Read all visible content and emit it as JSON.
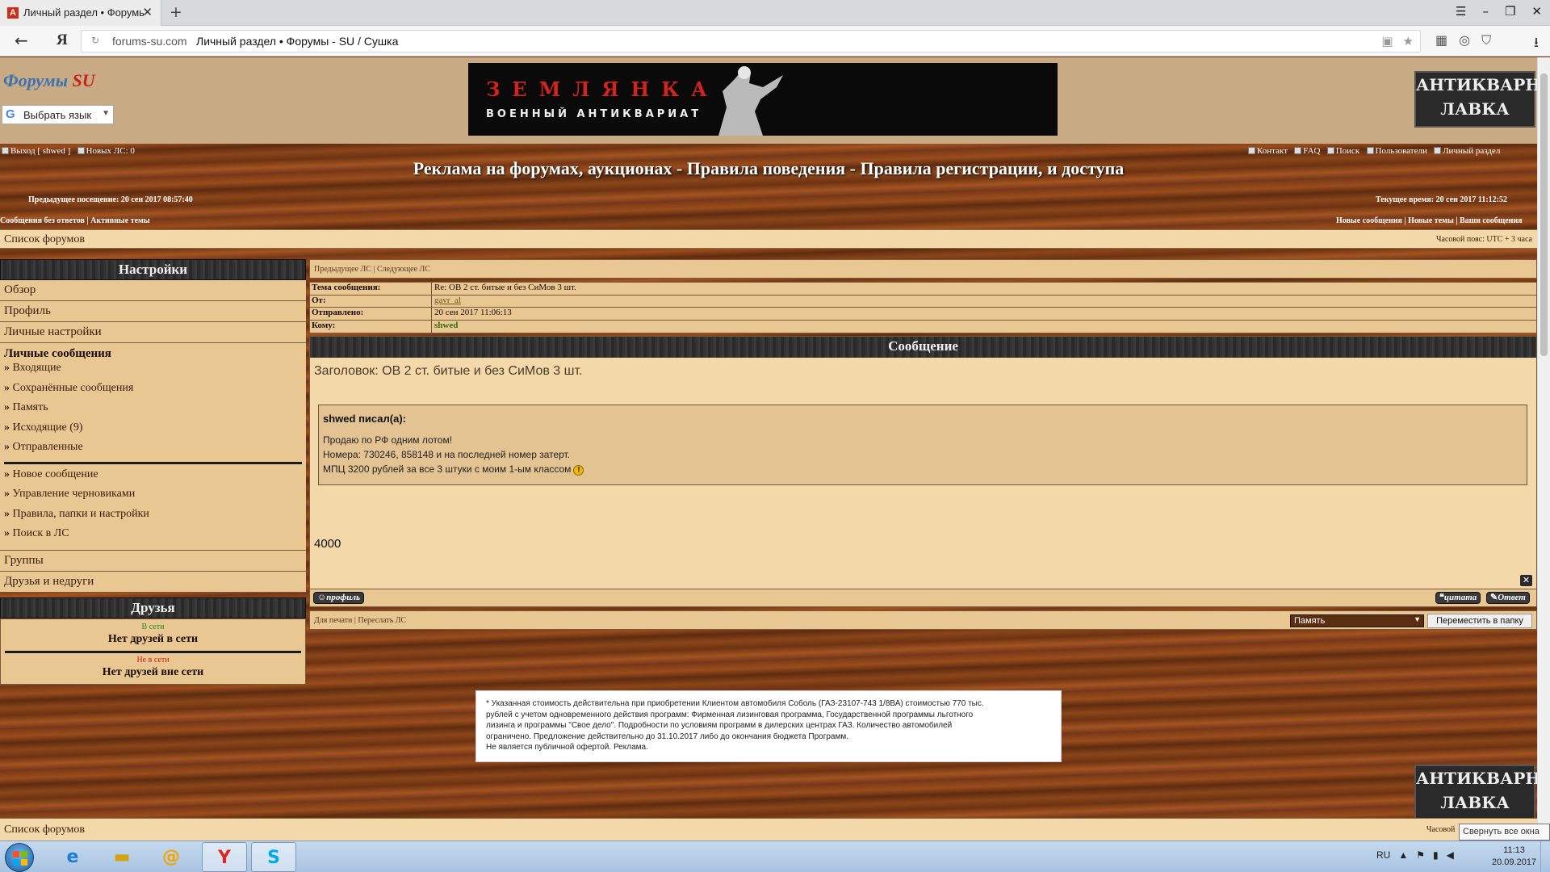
{
  "browser": {
    "tab_title": "Личный раздел • Форумы - SU / Сушка",
    "tab_icon": "A",
    "new_tab": "+",
    "close_tab": "✕",
    "yandex_logo": "Я",
    "url_host": "forums-su.com",
    "url_path": "Личный раздел • Форумы - SU / Сушка"
  },
  "header": {
    "logo_part1": "Форумы ",
    "logo_part2": "SU",
    "translate_label": "Выбрать язык",
    "banner_title": "ЗЕМЛЯНКА",
    "banner_subtitle": "ВОЕННЫЙ АНТИКВАРИАТ",
    "side_banner_line1": "АНТИКВАРНАЯ",
    "side_banner_line2": "ЛАВКА"
  },
  "toplinks": {
    "logout": "Выход [ shwed ]",
    "new_pm": "Новых ЛС: 0",
    "contact": "Контакт",
    "faq": "FAQ",
    "search": "Поиск",
    "users": "Пользователи",
    "personal": "Личный раздел"
  },
  "site_title": "Реклама на форумах, аукционах - Правила поведения - Правила регистрации, и доступа",
  "visit": {
    "previous": "Предыдущее посещение: 20 сен 2017 08:57:40",
    "current": "Текущее время: 20 сен 2017 11:12:52"
  },
  "quicklinks": {
    "left": "Сообщения без ответов | Активные темы",
    "right": "Новые сообщения | Новые темы | Ваши сообщения"
  },
  "navbar": {
    "forum_list": "Список форумов",
    "timezone": "Часовой пояс: UTC + 3 часа"
  },
  "settings": {
    "header": "Настройки",
    "items": [
      "Обзор",
      "Профиль",
      "Личные настройки"
    ],
    "pm_title": "Личные сообщения",
    "pm_links": [
      "Входящие",
      "Сохранённые сообщения",
      "Память",
      "Исходящие (9)",
      "Отправленные"
    ],
    "pm_actions": [
      "Новое сообщение",
      "Управление черновиками",
      "Правила, папки и настройки",
      "Поиск в ЛС"
    ],
    "groups": "Группы",
    "friends_foes": "Друзья и недруги"
  },
  "friends": {
    "header": "Друзья",
    "online_label": "В сети",
    "online_none": "Нет друзей в сети",
    "offline_label": "Не в сети",
    "offline_none": "Нет друзей вне сети"
  },
  "pm_nav": "Предыдущее ЛС | Следующее ЛС",
  "message_meta": {
    "subject_label": "Тема сообщения:",
    "subject": "Re: ОВ 2 ст. битые и без СиМов 3 шт.",
    "from_label": "От:",
    "from": "gavr_al",
    "sent_label": "Отправлено:",
    "sent": "20 сен 2017 11:06:13",
    "to_label": "Кому:",
    "to": "shwed"
  },
  "message": {
    "header": "Сообщение",
    "title": "Заголовок: ОВ 2 ст. битые и без СиМов 3 шт.",
    "quote_author": "shwed писал(а):",
    "quote_lines": [
      "Продаю по РФ одним лотом!",
      "Номера: 730246, 858148 и на последней номер затерт.",
      "МПЦ 3200 рублей за все 3 штуки с моим 1-ым классом"
    ],
    "body": "4000"
  },
  "actions": {
    "profile": "профиль",
    "quote": "цитата",
    "reply": "Ответ"
  },
  "footer_nav": {
    "left": "Для печати | Переслать ЛС",
    "folder_selected": "Память",
    "move_button": "Переместить в папку"
  },
  "ad_text": [
    "* Указанная стоимость действительна при приобретении Клиентом автомобиля Соболь (ГАЗ-23107-743 1/8ВА) стоимостью 770 тыс.",
    "рублей с учетом одновременного действия программ: Фирменная лизинговая программа, Государственной программы льготного",
    "лизинга и программы \"Свое дело\". Подробности по условиям программ в дилерских центрах ГАЗ. Количество автомобилей",
    "ограничено. Предложение действительно до 31.10.2017 либо до окончания бюджета Программ.",
    "Не является публичной офертой. Реклама."
  ],
  "bottom": {
    "forum_list": "Список форумов",
    "timezone_cut": "Часовой",
    "tooltip": "Свернуть все окна"
  },
  "taskbar": {
    "lang": "RU",
    "time": "11:13",
    "date": "20.09.2017"
  }
}
